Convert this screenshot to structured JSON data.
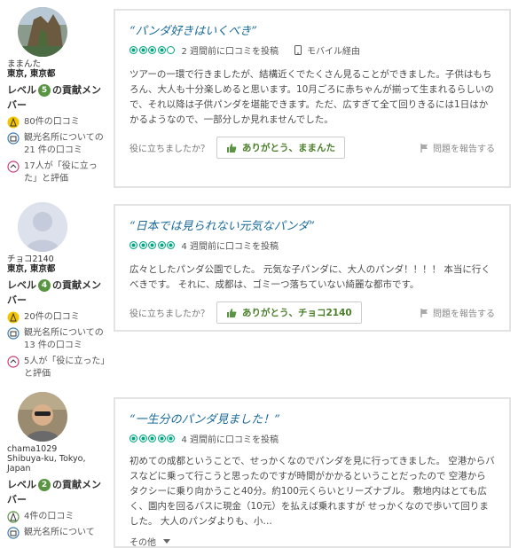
{
  "reviews": [
    {
      "user": {
        "name": "ままんた",
        "location": "東京, 東京都",
        "level": "5",
        "level_prefix": "レベル",
        "level_suffix": "の貢献メンバー",
        "reviews_count": "80件の口コミ",
        "attractions": "観光名所についての 21 件の口コミ",
        "helpful": "17人が「役に立った」と評価"
      },
      "title": "“パンダ好きはいくべき”",
      "rating": 4,
      "date": "2 週間前に口コミを投稿",
      "via": "モバイル経由",
      "body": "ツアーの一環で行きましたが、結構近くでたくさん見ることができました。子供はもちろん、大人も十分楽しめると思います。10月ごろに赤ちゃんが揃って生まれるらしいので、それ以降は子供パンダを堪能できます。ただ、広すぎて全て回りきるには1日はかかるようなので、一部分しか見れませんでした。",
      "helpful_q": "役に立ちましたか？",
      "thanks": "ありがとう、ままんた",
      "report": "問題を報告する"
    },
    {
      "user": {
        "name": "チョコ2140",
        "location": "東京, 東京都",
        "level": "4",
        "level_prefix": "レベル",
        "level_suffix": "の貢献メンバー",
        "reviews_count": "20件の口コミ",
        "attractions": "観光名所についての 13 件の口コミ",
        "helpful": "5人が「役に立った」と評価"
      },
      "title": "“日本では見られない元気なパンダ”",
      "rating": 5,
      "date": "4 週間前に口コミを投稿",
      "body": "広々としたパンダ公園でした。 元気な子パンダに、大人のパンダ！！！！ 本当に行くべきです。 それに、成都は、ゴミ一つ落ちていない綺麗な都市です。",
      "helpful_q": "役に立ちましたか？",
      "thanks": "ありがとう、チョコ2140",
      "report": "問題を報告する"
    },
    {
      "user": {
        "name": "chama1029",
        "location": "Shibuya-ku, Tokyo, Japan",
        "level": "2",
        "level_prefix": "レベル",
        "level_suffix": "の貢献メンバー",
        "reviews_count": "4件の口コミ",
        "attractions": "観光名所について"
      },
      "title": "“一生分のパンダ見ました！”",
      "rating": 5,
      "date": "4 週間前に口コミを投稿",
      "body": "初めての成都ということで、せっかくなのでパンダを見に行ってきました。 空港からバスなどに乗って行こうと思ったのですが時間がかかるということだったので 空港からタクシーに乗り向かうこと40分。約100元くらいとリーズナブル。 敷地内はとても広く、園内を回るバスに現金（10元）を払えば乗れますが せっかくなので歩いて回りました。 大人のパンダよりも、小…",
      "more": "その他"
    }
  ],
  "colors": {
    "accent": "#00a680",
    "title": "#1a6b9a",
    "level_badge": "#589442",
    "thanks_text": "#4a7f2a"
  },
  "icons": [
    "reviews-icon",
    "attractions-icon",
    "helpful-icon",
    "mobile-icon",
    "thumb-up-icon",
    "flag-icon",
    "chevron-down-icon"
  ]
}
